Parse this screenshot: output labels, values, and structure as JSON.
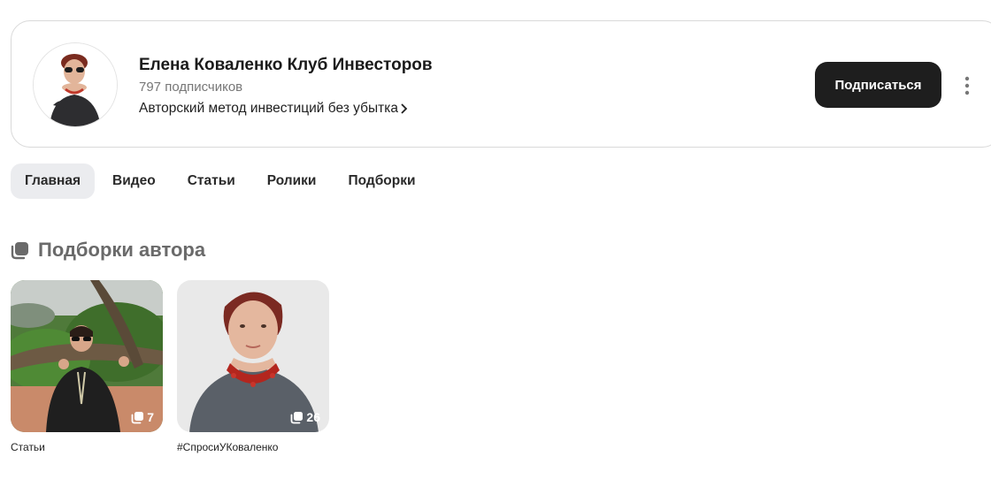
{
  "channel": {
    "name": "Елена Коваленко Клуб Инвесторов",
    "subscribers": "797 подписчиков",
    "description": "Авторский метод инвестиций без убытка",
    "subscribe_label": "Подписаться"
  },
  "tabs": [
    {
      "label": "Главная",
      "active": true
    },
    {
      "label": "Видео"
    },
    {
      "label": "Статьи"
    },
    {
      "label": "Ролики"
    },
    {
      "label": "Подборки"
    }
  ],
  "section": {
    "title": "Подборки автора"
  },
  "collections": [
    {
      "title": "Статьи",
      "count": "7"
    },
    {
      "title": "#СпросиУКоваленко",
      "count": "26"
    }
  ],
  "colors": {
    "button_bg": "#1e1e1e",
    "active_tab_bg": "#ebecef",
    "section_title": "#6a6a6a"
  },
  "icons": [
    "chevron-right-icon",
    "more-vertical-icon",
    "collection-icon",
    "stack-icon"
  ]
}
